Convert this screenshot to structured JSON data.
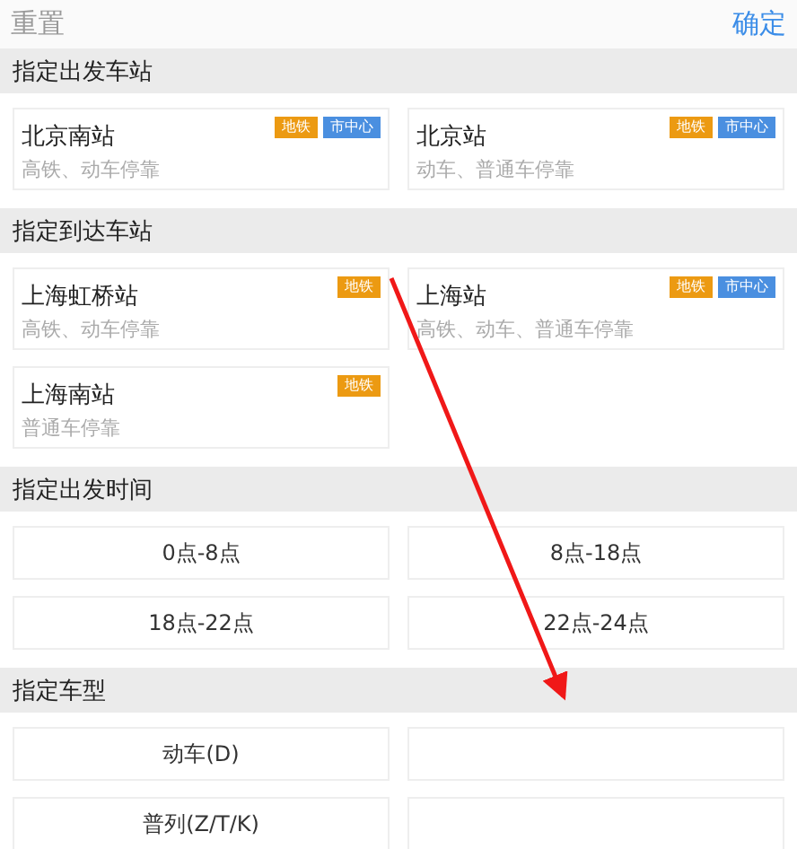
{
  "header": {
    "reset": "重置",
    "confirm": "确定"
  },
  "sections": [
    {
      "title": "指定出发车站",
      "kind": "stations",
      "items": [
        {
          "name": "北京南站",
          "desc": "高铁、动车停靠",
          "tags": [
            {
              "label": "地铁",
              "color": "#ec9a12"
            },
            {
              "label": "市中心",
              "color": "#4a8fe0"
            }
          ]
        },
        {
          "name": "北京站",
          "desc": "动车、普通车停靠",
          "tags": [
            {
              "label": "地铁",
              "color": "#ec9a12"
            },
            {
              "label": "市中心",
              "color": "#4a8fe0"
            }
          ]
        }
      ]
    },
    {
      "title": "指定到达车站",
      "kind": "stations",
      "items": [
        {
          "name": "上海虹桥站",
          "desc": "高铁、动车停靠",
          "tags": [
            {
              "label": "地铁",
              "color": "#ec9a12"
            }
          ]
        },
        {
          "name": "上海站",
          "desc": "高铁、动车、普通车停靠",
          "tags": [
            {
              "label": "地铁",
              "color": "#ec9a12"
            },
            {
              "label": "市中心",
              "color": "#4a8fe0"
            }
          ]
        },
        {
          "name": "上海南站",
          "desc": "普通车停靠",
          "tags": [
            {
              "label": "地铁",
              "color": "#ec9a12"
            }
          ]
        }
      ]
    },
    {
      "title": "指定出发时间",
      "kind": "options",
      "items": [
        {
          "kind": "text",
          "label": "0点-8点"
        },
        {
          "kind": "text",
          "label": "8点-18点"
        },
        {
          "kind": "text",
          "label": "18点-22点"
        },
        {
          "kind": "text",
          "label": "22点-24点"
        }
      ]
    },
    {
      "title": "指定车型",
      "kind": "options",
      "items": [
        {
          "kind": "text",
          "label": "动车(D)"
        },
        {
          "kind": "blank"
        },
        {
          "kind": "text",
          "label": "普列(Z/T/K)"
        },
        {
          "kind": "blank"
        }
      ]
    }
  ]
}
